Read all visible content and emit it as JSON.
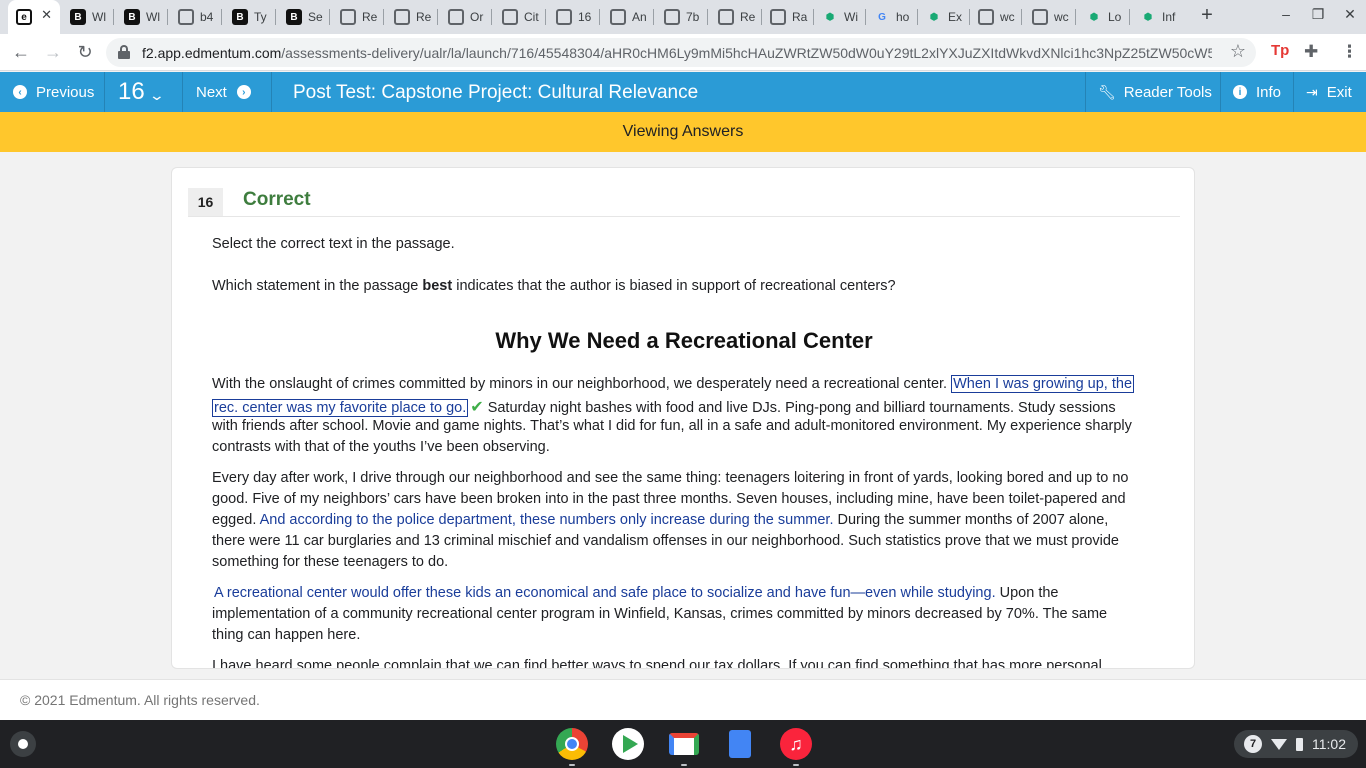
{
  "browser": {
    "tabs": [
      {
        "title": "",
        "favicon": "edmentum-icon",
        "active": true
      },
      {
        "title": "Wl",
        "favicon": "b-icon"
      },
      {
        "title": "Wl",
        "favicon": "b-icon"
      },
      {
        "title": "b4",
        "favicon": "globe-icon"
      },
      {
        "title": "Ty",
        "favicon": "b-icon"
      },
      {
        "title": "Se",
        "favicon": "b-icon"
      },
      {
        "title": "Re",
        "favicon": "globe-icon"
      },
      {
        "title": "Re",
        "favicon": "globe-icon"
      },
      {
        "title": "Or",
        "favicon": "globe-icon"
      },
      {
        "title": "Cit",
        "favicon": "globe-icon"
      },
      {
        "title": "16",
        "favicon": "globe-icon"
      },
      {
        "title": "An",
        "favicon": "globe-icon"
      },
      {
        "title": "7b",
        "favicon": "globe-icon"
      },
      {
        "title": "Re",
        "favicon": "globe-icon"
      },
      {
        "title": "Ra",
        "favicon": "globe-icon"
      },
      {
        "title": "Wi",
        "favicon": "hexagon-icon"
      },
      {
        "title": "ho",
        "favicon": "google-icon"
      },
      {
        "title": "Ex",
        "favicon": "hexagon-icon"
      },
      {
        "title": "wc",
        "favicon": "globe-icon"
      },
      {
        "title": "wc",
        "favicon": "globe-icon"
      },
      {
        "title": "Lo",
        "favicon": "hexagon-icon"
      },
      {
        "title": "Inf",
        "favicon": "hexagon-icon"
      }
    ],
    "new_tab": "+",
    "url_host": "f2.app.edmentum.com",
    "url_path": "/assessments-delivery/ualr/la/launch/716/45548304/aHR0cHM6Ly9mMi5hcHAuZWRtZW50dW0uY29tL2xlYXJuZXItdWkvdXNlci1hc3NpZ25tZW50cW50..."
  },
  "header": {
    "previous_label": "Previous",
    "question_number": "16",
    "next_label": "Next",
    "title": "Post Test: Capstone Project: Cultural Relevance",
    "reader_tools_label": "Reader Tools",
    "info_label": "Info",
    "exit_label": "Exit"
  },
  "banner": {
    "text": "Viewing Answers"
  },
  "question": {
    "number": "16",
    "status": "Correct",
    "instruction": "Select the correct text in the passage.",
    "prompt_pre": "Which statement in the passage ",
    "prompt_bold": "best",
    "prompt_post": " indicates that the author is biased in support of recreational centers?"
  },
  "passage": {
    "title": "Why We Need a Recreational Center",
    "p1": {
      "l1a": "With the onslaught of crimes committed by minors in our neighborhood, we desperately need a recreational center.",
      "l1b": "When I was growing up, the",
      "l2a": "rec. center was my favorite place to go.",
      "l2b": "Saturday night bashes with food and live DJs. Ping-pong and billiard tournaments. Study sessions",
      "l3": "with friends after school. Movie and game nights. That’s what I did for fun, all in a safe and adult-monitored environment. My experience sharply",
      "l4": "contrasts with that of the youths I’ve been observing."
    },
    "p2": {
      "l1": "Every day after work, I drive through our neighborhood and see the same thing: teenagers loitering in front of yards, looking bored and up to no",
      "l2": "good. Five of my neighbors’ cars have been broken into in the past three months. Seven houses, including mine, have been toilet-papered and",
      "l3a": "egged.",
      "l3b": "And according to the police department, these numbers only increase during the summer.",
      "l3c": "During the summer months of 2007 alone,",
      "l4": "there were 11 car burglaries and 13 criminal mischief and vandalism offenses in our neighborhood. Such statistics prove that we must provide",
      "l5": "something for these teenagers to do."
    },
    "p3": {
      "l1a": "A recreational center would offer these kids an economical and safe place to socialize and have fun—even while studying.",
      "l1b": "Upon the",
      "l2": "implementation of a community recreational center program in Winfield, Kansas, crimes committed by minors decreased by 70%. The same",
      "l3": "thing can happen here."
    },
    "p4": {
      "l1": "I have heard some people complain that we can find better ways to spend our tax dollars. If you can find something that has more personal"
    }
  },
  "footer": {
    "copyright": "© 2021 Edmentum. All rights reserved."
  },
  "shelf": {
    "apps": [
      "chrome-icon",
      "play-store-icon",
      "gmail-icon",
      "docs-icon",
      "music-icon"
    ],
    "notification_count": "7",
    "time": "11:02"
  },
  "colors": {
    "header_blue": "#2b9bd6",
    "banner_yellow": "#ffc72c",
    "correct_green": "#3e7d3e",
    "selectable_blue": "#1a3d9a",
    "check_green": "#3fae49"
  }
}
